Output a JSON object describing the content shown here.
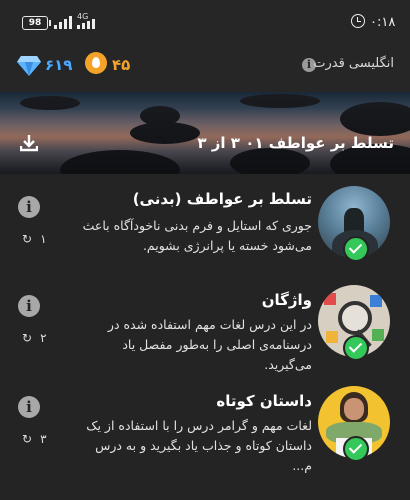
{
  "status_bar": {
    "battery": "98",
    "network": "4G",
    "time": "۰:۱۸"
  },
  "header": {
    "gems": "۶۱۹",
    "streak": "۴۵",
    "course_name": "انگلیسی قدرت",
    "accent_gem": "#4aa8ff",
    "accent_streak": "#f4a32a"
  },
  "banner": {
    "title": "تسلط بر عواطف ۰۱ ۳ از ۳"
  },
  "lessons": [
    {
      "title": "تسلط بر عواطف (بدنی)",
      "description": "جوری که استایل و فرم بدنی ناخودآگاه باعث می‌شود خسته یا پرانرژی بشویم.",
      "repeat_count": "۱",
      "completed": true
    },
    {
      "title": "واژگان",
      "description": "در این درس لغات مهم استفاده شده در درسنامه‌ی اصلی را به‌طور مفصل یاد می‌گیرید.",
      "repeat_count": "۲",
      "completed": true
    },
    {
      "title": "داستان کوتاه",
      "description": "لغات مهم و گرامر درس را با استفاده از یک داستان کوتاه و جذاب یاد بگیرید و به درس م...",
      "repeat_count": "۳",
      "completed": true
    }
  ],
  "colors": {
    "background": "#242424",
    "check": "#34c759"
  }
}
